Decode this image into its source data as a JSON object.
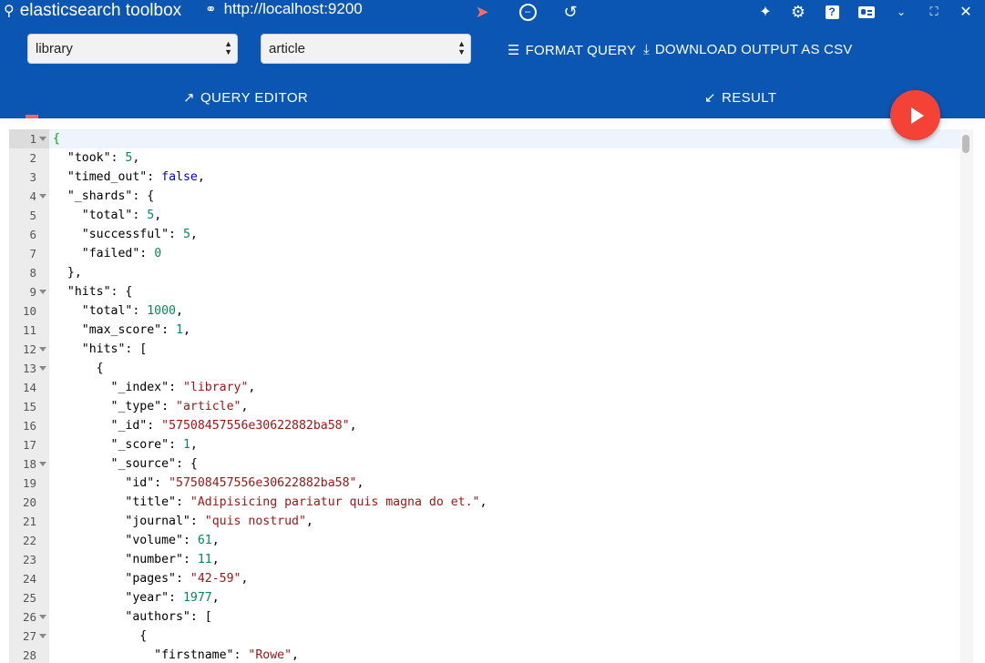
{
  "app": {
    "title": "elasticsearch toolbox",
    "url": "http://localhost:9200"
  },
  "toolbar": {
    "icons": [
      "send-icon",
      "minus-circle-icon",
      "history-icon",
      "puzzle-icon",
      "gear-icon",
      "help-icon",
      "profile-card-icon",
      "chevron-down-icon",
      "fullscreen-icon",
      "close-icon"
    ],
    "index_select": "library",
    "type_select": "article",
    "format_label": "FORMAT QUERY",
    "download_label": "DOWNLOAD OUTPUT AS CSV"
  },
  "tabs": {
    "query_editor": "QUERY EDITOR",
    "result": "RESULT"
  },
  "editor": {
    "lines": [
      {
        "n": "1",
        "fold": true,
        "indent": "",
        "parts": [
          [
            "brace-green",
            "{"
          ]
        ]
      },
      {
        "n": "2",
        "fold": false,
        "indent": "  ",
        "parts": [
          [
            "k",
            "\"took\""
          ],
          [
            "p",
            ": "
          ],
          [
            "n",
            "5"
          ],
          [
            "p",
            ","
          ]
        ]
      },
      {
        "n": "3",
        "fold": false,
        "indent": "  ",
        "parts": [
          [
            "k",
            "\"timed_out\""
          ],
          [
            "p",
            ": "
          ],
          [
            "b",
            "false"
          ],
          [
            "p",
            ","
          ]
        ]
      },
      {
        "n": "4",
        "fold": true,
        "indent": "  ",
        "parts": [
          [
            "k",
            "\"_shards\""
          ],
          [
            "p",
            ": {"
          ]
        ]
      },
      {
        "n": "5",
        "fold": false,
        "indent": "    ",
        "parts": [
          [
            "k",
            "\"total\""
          ],
          [
            "p",
            ": "
          ],
          [
            "n",
            "5"
          ],
          [
            "p",
            ","
          ]
        ]
      },
      {
        "n": "6",
        "fold": false,
        "indent": "    ",
        "parts": [
          [
            "k",
            "\"successful\""
          ],
          [
            "p",
            ": "
          ],
          [
            "n",
            "5"
          ],
          [
            "p",
            ","
          ]
        ]
      },
      {
        "n": "7",
        "fold": false,
        "indent": "    ",
        "parts": [
          [
            "k",
            "\"failed\""
          ],
          [
            "p",
            ": "
          ],
          [
            "n",
            "0"
          ]
        ]
      },
      {
        "n": "8",
        "fold": false,
        "indent": "  ",
        "parts": [
          [
            "p",
            "},"
          ]
        ]
      },
      {
        "n": "9",
        "fold": true,
        "indent": "  ",
        "parts": [
          [
            "k",
            "\"hits\""
          ],
          [
            "p",
            ": {"
          ]
        ]
      },
      {
        "n": "10",
        "fold": false,
        "indent": "    ",
        "parts": [
          [
            "k",
            "\"total\""
          ],
          [
            "p",
            ": "
          ],
          [
            "n",
            "1000"
          ],
          [
            "p",
            ","
          ]
        ]
      },
      {
        "n": "11",
        "fold": false,
        "indent": "    ",
        "parts": [
          [
            "k",
            "\"max_score\""
          ],
          [
            "p",
            ": "
          ],
          [
            "n",
            "1"
          ],
          [
            "p",
            ","
          ]
        ]
      },
      {
        "n": "12",
        "fold": true,
        "indent": "    ",
        "parts": [
          [
            "k",
            "\"hits\""
          ],
          [
            "p",
            ": ["
          ]
        ]
      },
      {
        "n": "13",
        "fold": true,
        "indent": "      ",
        "parts": [
          [
            "p",
            "{"
          ]
        ]
      },
      {
        "n": "14",
        "fold": false,
        "indent": "        ",
        "parts": [
          [
            "k",
            "\"_index\""
          ],
          [
            "p",
            ": "
          ],
          [
            "s",
            "\"library\""
          ],
          [
            "p",
            ","
          ]
        ]
      },
      {
        "n": "15",
        "fold": false,
        "indent": "        ",
        "parts": [
          [
            "k",
            "\"_type\""
          ],
          [
            "p",
            ": "
          ],
          [
            "s",
            "\"article\""
          ],
          [
            "p",
            ","
          ]
        ]
      },
      {
        "n": "16",
        "fold": false,
        "indent": "        ",
        "parts": [
          [
            "k",
            "\"_id\""
          ],
          [
            "p",
            ": "
          ],
          [
            "s",
            "\"57508457556e30622882ba58\""
          ],
          [
            "p",
            ","
          ]
        ]
      },
      {
        "n": "17",
        "fold": false,
        "indent": "        ",
        "parts": [
          [
            "k",
            "\"_score\""
          ],
          [
            "p",
            ": "
          ],
          [
            "n",
            "1"
          ],
          [
            "p",
            ","
          ]
        ]
      },
      {
        "n": "18",
        "fold": true,
        "indent": "        ",
        "parts": [
          [
            "k",
            "\"_source\""
          ],
          [
            "p",
            ": {"
          ]
        ]
      },
      {
        "n": "19",
        "fold": false,
        "indent": "          ",
        "parts": [
          [
            "k",
            "\"id\""
          ],
          [
            "p",
            ": "
          ],
          [
            "s",
            "\"57508457556e30622882ba58\""
          ],
          [
            "p",
            ","
          ]
        ]
      },
      {
        "n": "20",
        "fold": false,
        "indent": "          ",
        "parts": [
          [
            "k",
            "\"title\""
          ],
          [
            "p",
            ": "
          ],
          [
            "s",
            "\"Adipisicing pariatur quis magna do et.\""
          ],
          [
            "p",
            ","
          ]
        ]
      },
      {
        "n": "21",
        "fold": false,
        "indent": "          ",
        "parts": [
          [
            "k",
            "\"journal\""
          ],
          [
            "p",
            ": "
          ],
          [
            "s",
            "\"quis nostrud\""
          ],
          [
            "p",
            ","
          ]
        ]
      },
      {
        "n": "22",
        "fold": false,
        "indent": "          ",
        "parts": [
          [
            "k",
            "\"volume\""
          ],
          [
            "p",
            ": "
          ],
          [
            "n",
            "61"
          ],
          [
            "p",
            ","
          ]
        ]
      },
      {
        "n": "23",
        "fold": false,
        "indent": "          ",
        "parts": [
          [
            "k",
            "\"number\""
          ],
          [
            "p",
            ": "
          ],
          [
            "n",
            "11"
          ],
          [
            "p",
            ","
          ]
        ]
      },
      {
        "n": "24",
        "fold": false,
        "indent": "          ",
        "parts": [
          [
            "k",
            "\"pages\""
          ],
          [
            "p",
            ": "
          ],
          [
            "s",
            "\"42-59\""
          ],
          [
            "p",
            ","
          ]
        ]
      },
      {
        "n": "25",
        "fold": false,
        "indent": "          ",
        "parts": [
          [
            "k",
            "\"year\""
          ],
          [
            "p",
            ": "
          ],
          [
            "n",
            "1977"
          ],
          [
            "p",
            ","
          ]
        ]
      },
      {
        "n": "26",
        "fold": true,
        "indent": "          ",
        "parts": [
          [
            "k",
            "\"authors\""
          ],
          [
            "p",
            ": ["
          ]
        ]
      },
      {
        "n": "27",
        "fold": true,
        "indent": "            ",
        "parts": [
          [
            "p",
            "{"
          ]
        ]
      },
      {
        "n": "28",
        "fold": false,
        "indent": "              ",
        "parts": [
          [
            "k",
            "\"firstname\""
          ],
          [
            "p",
            ": "
          ],
          [
            "s",
            "\"Rowe\""
          ],
          [
            "p",
            ","
          ]
        ]
      }
    ]
  }
}
